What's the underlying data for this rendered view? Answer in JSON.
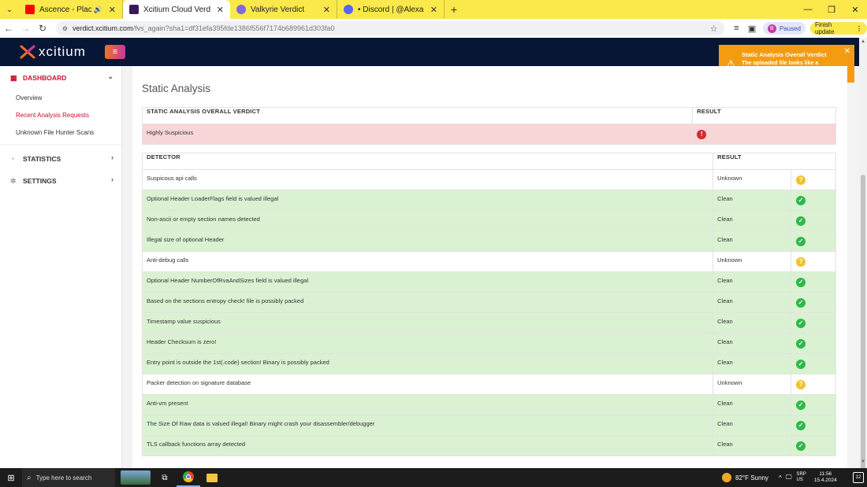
{
  "browser": {
    "tabs": [
      {
        "title": "Ascence - Places Like That |",
        "favicon_color": "#ff0000",
        "audio_icon": "🔊",
        "active": false
      },
      {
        "title": "Xcitium Cloud Verdict",
        "favicon_color": "#3b1a5a",
        "active": true
      },
      {
        "title": "Valkyrie Verdict",
        "favicon_color": "#7d6bd8",
        "active": false
      },
      {
        "title": "• Discord | @Alexander R. Broo",
        "favicon_color": "#5865f2",
        "active": false
      }
    ],
    "url_host": "verdict.xcitium.com",
    "url_path": "/fvs_again?sha1=df31efa395fde1386f556f7174b689961d303fa0",
    "profile_label": "Paused",
    "profile_initial": "B",
    "update_label": "Finish update"
  },
  "app": {
    "logo_text": "xcitium",
    "menu_icon": "hamburger-icon"
  },
  "sidebar": {
    "dashboard_label": "DASHBOARD",
    "dashboard_items": [
      {
        "label": "Overview",
        "active": false
      },
      {
        "label": "Recent Analysis Requests",
        "active": true
      },
      {
        "label": "Unknown File Hunter Scans",
        "active": false
      }
    ],
    "statistics_label": "STATISTICS",
    "settings_label": "SETTINGS"
  },
  "main": {
    "title": "Static Analysis",
    "verdict_table": {
      "headers": [
        "STATIC ANALYSIS OVERALL VERDICT",
        "RESULT"
      ],
      "row": {
        "verdict": "Highly Suspicious",
        "result_icon": "alert-icon"
      }
    },
    "detector_table": {
      "headers": [
        "DETECTOR",
        "RESULT"
      ],
      "rows": [
        {
          "detector": "Suspicous api calls",
          "result": "Unknown"
        },
        {
          "detector": "Optional Header LoaderFlags field is valued illegal",
          "result": "Clean"
        },
        {
          "detector": "Non-ascii or empty section names detected",
          "result": "Clean"
        },
        {
          "detector": "Illegal size of optional Header",
          "result": "Clean"
        },
        {
          "detector": "Anti-debug calls",
          "result": "Unknown"
        },
        {
          "detector": "Optional Header NumberOfRvaAndSizes field is valued illegal",
          "result": "Clean"
        },
        {
          "detector": "Based on the sections entropy check! file is possibly packed",
          "result": "Clean"
        },
        {
          "detector": "Timestamp value suspicious",
          "result": "Clean"
        },
        {
          "detector": "Header Checksum is zero!",
          "result": "Clean"
        },
        {
          "detector": "Entry point is outside the 1st(.code) section! Binary is possibly packed",
          "result": "Clean"
        },
        {
          "detector": "Packer detection on signature database",
          "result": "Unknown"
        },
        {
          "detector": "Anti-vm present",
          "result": "Clean"
        },
        {
          "detector": "The Size Of Raw data is valued illegal! Binary might crash your disassembler/debugger",
          "result": "Clean"
        },
        {
          "detector": "TLS callback functions array detected",
          "result": "Clean"
        }
      ]
    }
  },
  "toast": {
    "title": "Static Analysis Overall Verdict",
    "message": "The uploaded file looks like a malicious file",
    "color": "#f39c12"
  },
  "colors": {
    "clean_row": "#daf2d2",
    "suspicious_row": "#f8d6d8",
    "accent_red": "#c8102e",
    "header_bg": "#081636"
  },
  "taskbar": {
    "search_placeholder": "Type here to search",
    "weather": "82°F  Sunny",
    "lang_top": "SRP",
    "lang_bottom": "US",
    "time": "11:56",
    "date": "15.4.2024",
    "notif_count": "12"
  }
}
